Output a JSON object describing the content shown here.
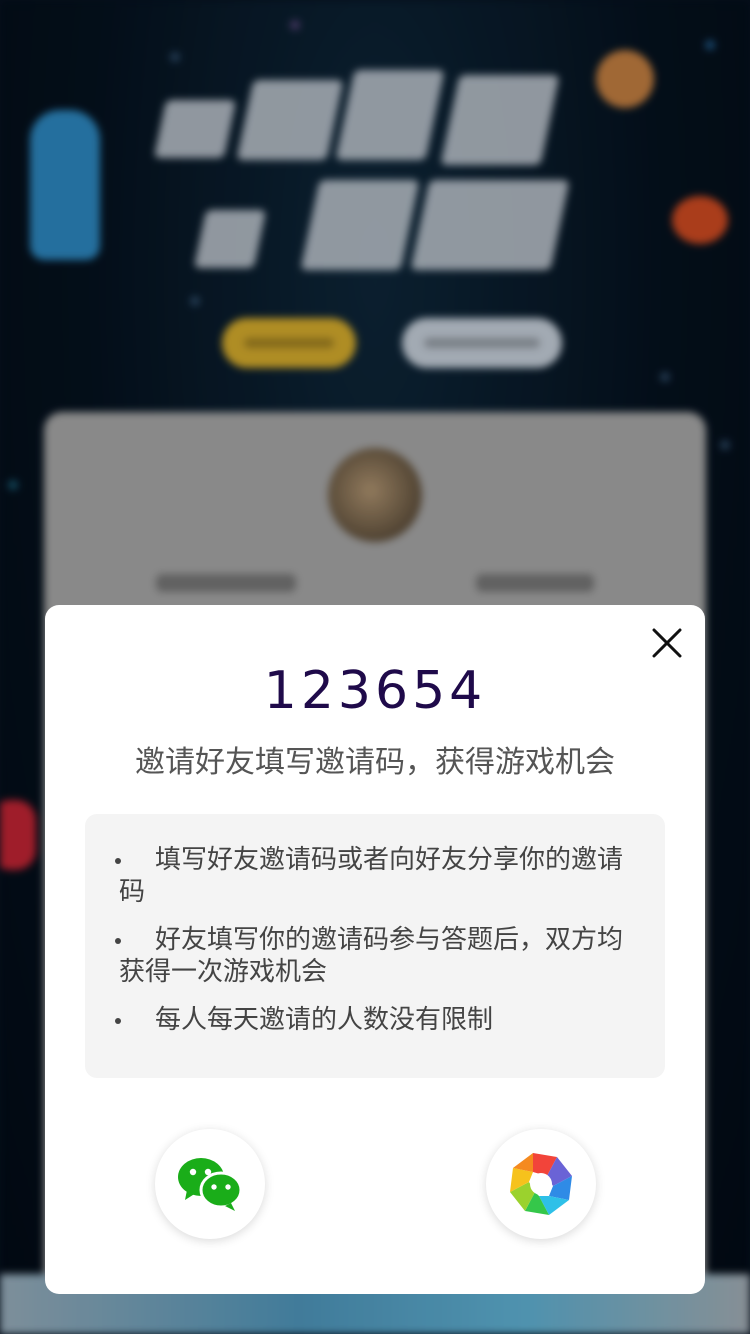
{
  "modal": {
    "invite_code": "123654",
    "subtitle": "邀请好友填写邀请码，获得游戏机会",
    "rules": [
      "填写好友邀请码或者向好友分享你的邀请码",
      "好友填写你的邀请码参与答题后，双方均获得一次游戏机会",
      "每人每天邀请的人数没有限制"
    ],
    "close_icon": "close-icon",
    "share_buttons": [
      {
        "id": "wechat",
        "icon": "wechat-icon"
      },
      {
        "id": "moments",
        "icon": "moments-icon"
      }
    ]
  },
  "colors": {
    "code_color": "#1f0a4a",
    "wechat_green": "#1aad19",
    "text_gray": "#555555"
  }
}
